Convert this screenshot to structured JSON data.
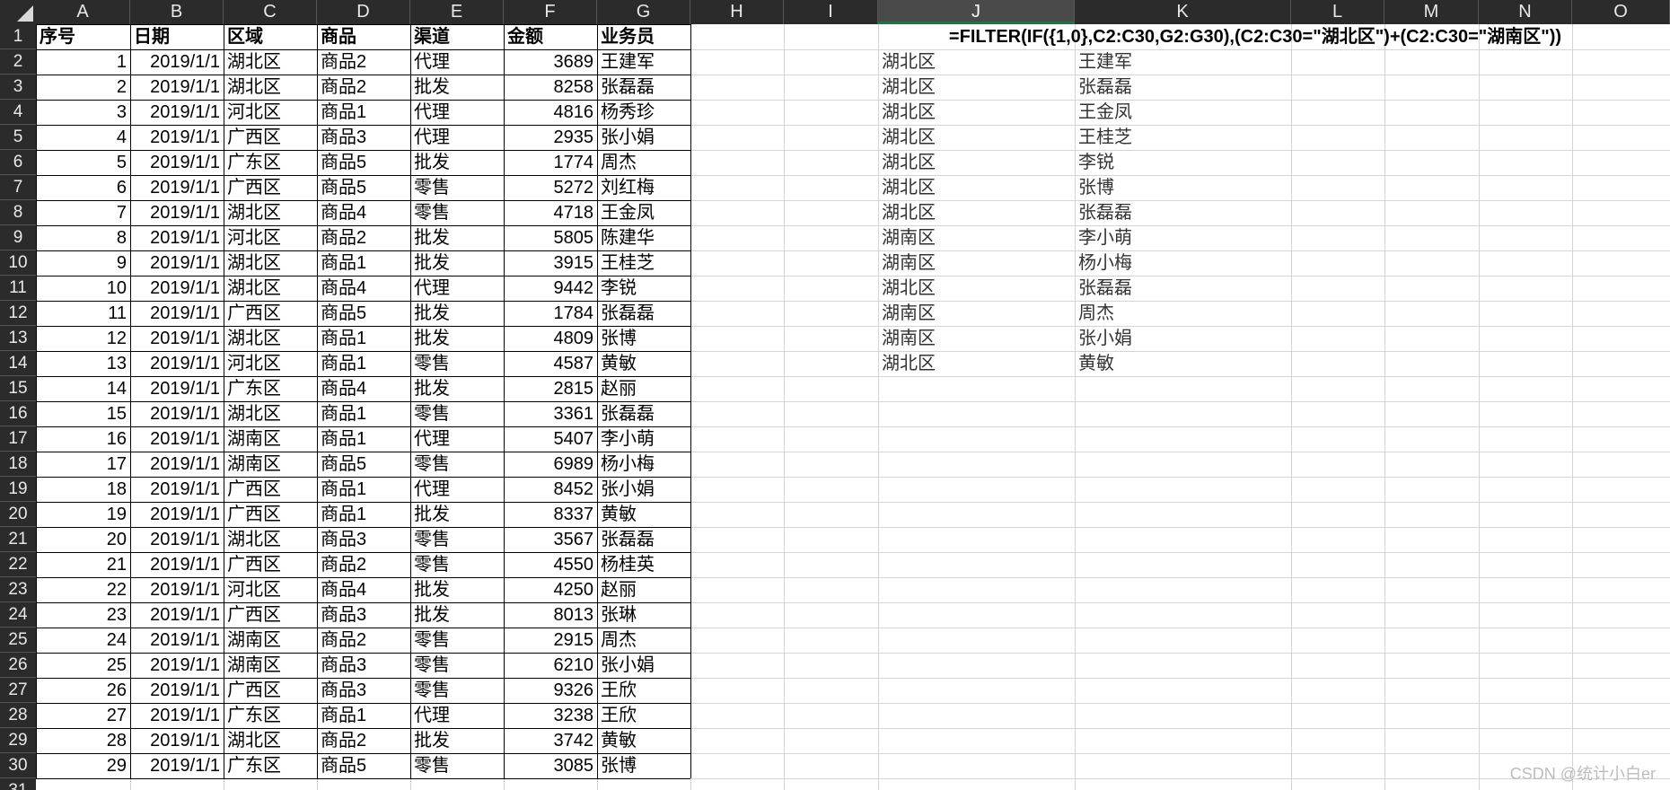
{
  "columns": [
    "A",
    "B",
    "C",
    "D",
    "E",
    "F",
    "G",
    "H",
    "I",
    "J",
    "K",
    "L",
    "M",
    "N",
    "O"
  ],
  "headers": [
    "序号",
    "日期",
    "区域",
    "商品",
    "渠道",
    "金额",
    "业务员"
  ],
  "rows": [
    [
      "1",
      "2019/1/1",
      "湖北区",
      "商品2",
      "代理",
      "3689",
      "王建军"
    ],
    [
      "2",
      "2019/1/1",
      "湖北区",
      "商品2",
      "批发",
      "8258",
      "张磊磊"
    ],
    [
      "3",
      "2019/1/1",
      "河北区",
      "商品1",
      "代理",
      "4816",
      "杨秀珍"
    ],
    [
      "4",
      "2019/1/1",
      "广西区",
      "商品3",
      "代理",
      "2935",
      "张小娟"
    ],
    [
      "5",
      "2019/1/1",
      "广东区",
      "商品5",
      "批发",
      "1774",
      "周杰"
    ],
    [
      "6",
      "2019/1/1",
      "广西区",
      "商品5",
      "零售",
      "5272",
      "刘红梅"
    ],
    [
      "7",
      "2019/1/1",
      "湖北区",
      "商品4",
      "零售",
      "4718",
      "王金凤"
    ],
    [
      "8",
      "2019/1/1",
      "河北区",
      "商品2",
      "批发",
      "5805",
      "陈建华"
    ],
    [
      "9",
      "2019/1/1",
      "湖北区",
      "商品1",
      "批发",
      "3915",
      "王桂芝"
    ],
    [
      "10",
      "2019/1/1",
      "湖北区",
      "商品4",
      "代理",
      "9442",
      "李锐"
    ],
    [
      "11",
      "2019/1/1",
      "广西区",
      "商品5",
      "批发",
      "1784",
      "张磊磊"
    ],
    [
      "12",
      "2019/1/1",
      "湖北区",
      "商品1",
      "批发",
      "4809",
      "张博"
    ],
    [
      "13",
      "2019/1/1",
      "河北区",
      "商品1",
      "零售",
      "4587",
      "黄敏"
    ],
    [
      "14",
      "2019/1/1",
      "广东区",
      "商品4",
      "批发",
      "2815",
      "赵丽"
    ],
    [
      "15",
      "2019/1/1",
      "湖北区",
      "商品1",
      "零售",
      "3361",
      "张磊磊"
    ],
    [
      "16",
      "2019/1/1",
      "湖南区",
      "商品1",
      "代理",
      "5407",
      "李小萌"
    ],
    [
      "17",
      "2019/1/1",
      "湖南区",
      "商品5",
      "零售",
      "6989",
      "杨小梅"
    ],
    [
      "18",
      "2019/1/1",
      "广西区",
      "商品1",
      "代理",
      "8452",
      "张小娟"
    ],
    [
      "19",
      "2019/1/1",
      "广西区",
      "商品1",
      "批发",
      "8337",
      "黄敏"
    ],
    [
      "20",
      "2019/1/1",
      "湖北区",
      "商品3",
      "零售",
      "3567",
      "张磊磊"
    ],
    [
      "21",
      "2019/1/1",
      "广西区",
      "商品2",
      "零售",
      "4550",
      "杨桂英"
    ],
    [
      "22",
      "2019/1/1",
      "河北区",
      "商品4",
      "批发",
      "4250",
      "赵丽"
    ],
    [
      "23",
      "2019/1/1",
      "广西区",
      "商品3",
      "批发",
      "8013",
      "张琳"
    ],
    [
      "24",
      "2019/1/1",
      "湖南区",
      "商品2",
      "零售",
      "2915",
      "周杰"
    ],
    [
      "25",
      "2019/1/1",
      "湖南区",
      "商品3",
      "零售",
      "6210",
      "张小娟"
    ],
    [
      "26",
      "2019/1/1",
      "广西区",
      "商品3",
      "零售",
      "9326",
      "王欣"
    ],
    [
      "27",
      "2019/1/1",
      "广东区",
      "商品1",
      "代理",
      "3238",
      "王欣"
    ],
    [
      "28",
      "2019/1/1",
      "湖北区",
      "商品2",
      "批发",
      "3742",
      "黄敏"
    ],
    [
      "29",
      "2019/1/1",
      "广东区",
      "商品5",
      "零售",
      "3085",
      "张博"
    ]
  ],
  "row_numbers": [
    "1",
    "2",
    "3",
    "4",
    "5",
    "6",
    "7",
    "8",
    "9",
    "10",
    "11",
    "12",
    "13",
    "14",
    "15",
    "16",
    "17",
    "18",
    "19",
    "20",
    "21",
    "22",
    "23",
    "24",
    "25",
    "26",
    "27",
    "28",
    "29",
    "30",
    "31"
  ],
  "formula": "=FILTER(IF({1,0},C2:C30,G2:G30),(C2:C30=\"湖北区\")+(C2:C30=\"湖南区\"))",
  "filter_results": [
    [
      "湖北区",
      "王建军"
    ],
    [
      "湖北区",
      "张磊磊"
    ],
    [
      "湖北区",
      "王金凤"
    ],
    [
      "湖北区",
      "王桂芝"
    ],
    [
      "湖北区",
      "李锐"
    ],
    [
      "湖北区",
      "张博"
    ],
    [
      "湖北区",
      "张磊磊"
    ],
    [
      "湖南区",
      "李小萌"
    ],
    [
      "湖南区",
      "杨小梅"
    ],
    [
      "湖北区",
      "张磊磊"
    ],
    [
      "湖南区",
      "周杰"
    ],
    [
      "湖南区",
      "张小娟"
    ],
    [
      "湖北区",
      "黄敏"
    ]
  ],
  "watermark": "CSDN @统计小白er",
  "colors": {
    "header_bg": "#2b2b2b",
    "accent": "#217346"
  }
}
